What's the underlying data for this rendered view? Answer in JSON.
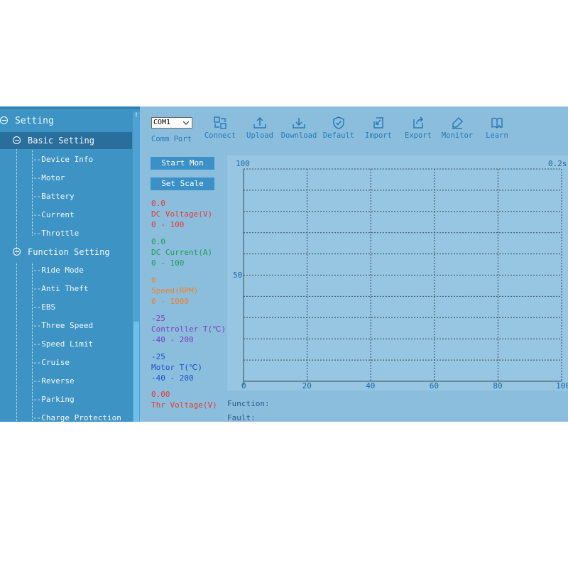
{
  "sidebar": {
    "root": "Setting",
    "basic": {
      "label": "Basic Setting",
      "items": [
        "Device Info",
        "Motor",
        "Battery",
        "Current",
        "Throttle"
      ]
    },
    "function": {
      "label": "Function Setting",
      "items": [
        "Ride Mode",
        "Anti Theft",
        "EBS",
        "Three Speed",
        "Speed Limit",
        "Cruise",
        "Reverse",
        "Parking",
        "Charge Protection"
      ]
    }
  },
  "toolbar": {
    "com_port_value": "COM1",
    "comm_port_label": "Comm Port",
    "tools": [
      {
        "label": "Connect",
        "icon": "connect-icon"
      },
      {
        "label": "Upload",
        "icon": "upload-icon"
      },
      {
        "label": "Download",
        "icon": "download-icon"
      },
      {
        "label": "Default",
        "icon": "shield-check-icon"
      },
      {
        "label": "Import",
        "icon": "import-icon"
      },
      {
        "label": "Export",
        "icon": "export-icon"
      },
      {
        "label": "Monitor",
        "icon": "monitor-icon"
      },
      {
        "label": "Learn",
        "icon": "book-icon"
      }
    ]
  },
  "monitor": {
    "start_label": "Start Mon",
    "scale_label": "Set Scale",
    "readings": [
      {
        "value": "0.0",
        "name": "DC Voltage(V)",
        "range": "0 - 100",
        "color": "#e53935"
      },
      {
        "value": "0.0",
        "name": "DC Current(A)",
        "range": "0 - 100",
        "color": "#1e9e55"
      },
      {
        "value": "0",
        "name": "Speed(RPM)",
        "range": "0 - 1000",
        "color": "#f07f2a"
      },
      {
        "value": "-25",
        "name": "Controller T(℃)",
        "range": "-40 - 200",
        "color": "#7b3fc4"
      },
      {
        "value": "-25",
        "name": "Motor T(℃)",
        "range": "-40 - 200",
        "color": "#1c4fd0"
      },
      {
        "value": "0.00",
        "name": "Thr Voltage(V)",
        "range": "",
        "color": "#e53935"
      }
    ]
  },
  "chart": {
    "y_max_label": "100",
    "y_mid_label": "50",
    "time_label": "0.2s",
    "x_ticks": [
      "0",
      "20",
      "40",
      "60",
      "80",
      "100"
    ],
    "grid_color": "#3a4a5a"
  },
  "status": {
    "function_label": "Function:",
    "fault_label": "Fault:"
  }
}
